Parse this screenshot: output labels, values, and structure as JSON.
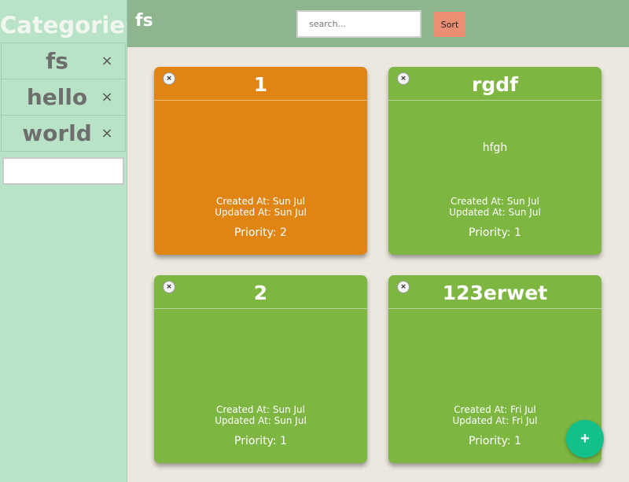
{
  "sidebar": {
    "title": "Categories",
    "items": [
      {
        "label": "fs",
        "close": "×"
      },
      {
        "label": "hello",
        "close": "×"
      },
      {
        "label": "world",
        "close": "×"
      }
    ],
    "new_category_value": ""
  },
  "header": {
    "title": "fs",
    "search_placeholder": "search...",
    "sort_label": "Sort"
  },
  "cards": [
    {
      "title": "1",
      "content": "",
      "created": "Created At: Sun Jul",
      "updated": "Updated At: Sun Jul",
      "priority": "Priority: 2",
      "color": "#e08413",
      "close": "×"
    },
    {
      "title": "rgdf",
      "content": "hfgh",
      "created": "Created At: Sun Jul",
      "updated": "Updated At: Sun Jul",
      "priority": "Priority: 1",
      "color": "#7db640",
      "close": "×"
    },
    {
      "title": "2",
      "content": "",
      "created": "Created At: Sun Jul",
      "updated": "Updated At: Sun Jul",
      "priority": "Priority: 1",
      "color": "#7db640",
      "close": "×"
    },
    {
      "title": "123erwet",
      "content": "",
      "created": "Created At: Fri Jul",
      "updated": "Updated At: Fri Jul",
      "priority": "Priority: 1",
      "color": "#7db640",
      "close": "×"
    }
  ],
  "fab_label": "+",
  "colors": {
    "sidebar_bg": "#b9e3c6",
    "header_bg": "#8fb58f",
    "page_bg": "#ece8df",
    "sort_button": "#ec8e74",
    "fab": "#13c08b"
  }
}
